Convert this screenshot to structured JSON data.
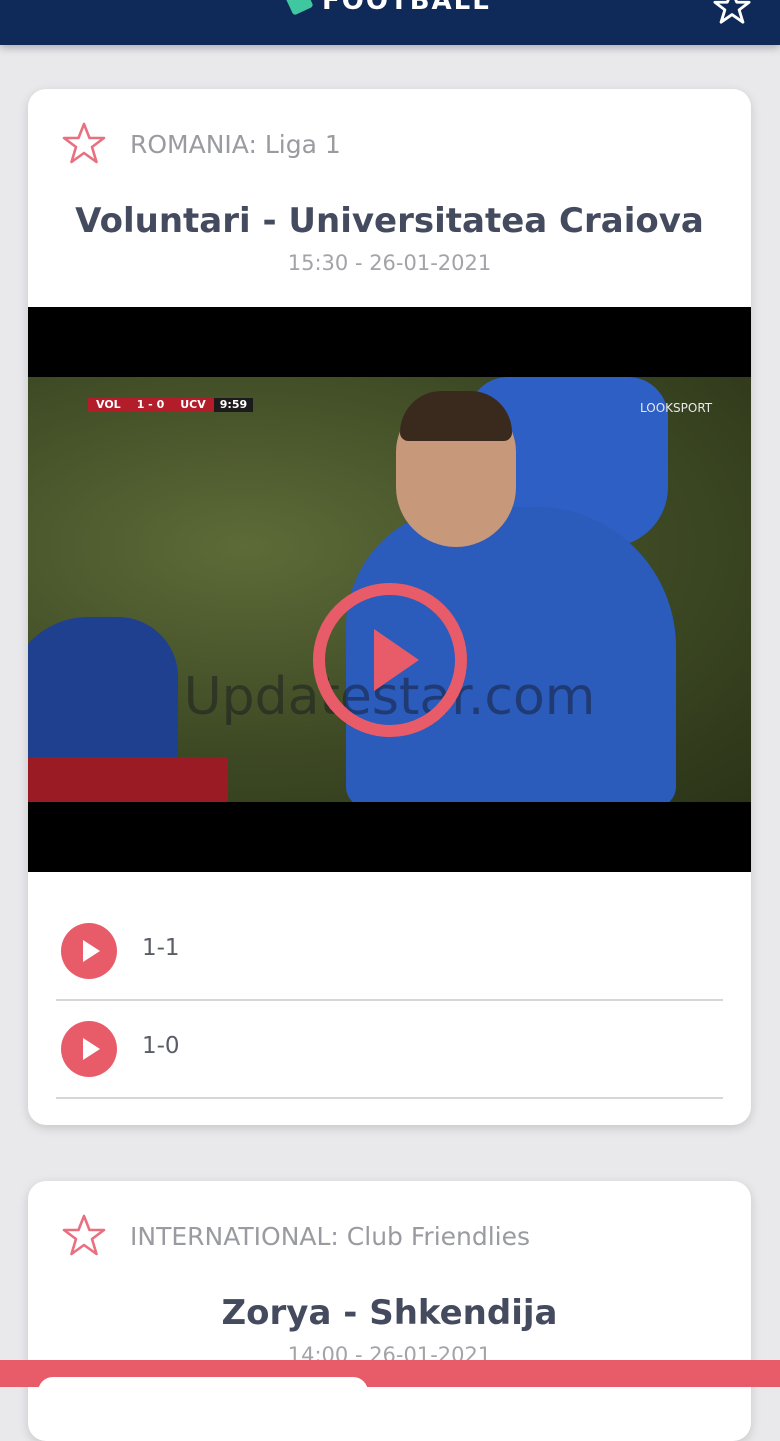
{
  "app": {
    "name": "FOOTBALL"
  },
  "header": {
    "logo_icon": "ball-logo-icon",
    "favorites_icon": "star-icon"
  },
  "matches": [
    {
      "league": "ROMANIA: Liga 1",
      "title": "Voluntari - Universitatea Craiova",
      "datetime": "15:30 - 26-01-2021",
      "video": {
        "scoreboard": {
          "home": "VOL",
          "score": "1 - 0",
          "away": "UCV",
          "clock": "9:59"
        },
        "broadcaster": "LOOKSPORT",
        "watermark": "Updatestar.com"
      },
      "highlights": [
        {
          "label": "1-1"
        },
        {
          "label": "1-0"
        }
      ]
    },
    {
      "league": "INTERNATIONAL: Club Friendlies",
      "title": "Zorya - Shkendija",
      "datetime": "14:00 - 26-01-2021"
    }
  ],
  "colors": {
    "accent": "#e85c6a",
    "header_bg": "#0f2a58",
    "title_text": "#454b5e"
  }
}
